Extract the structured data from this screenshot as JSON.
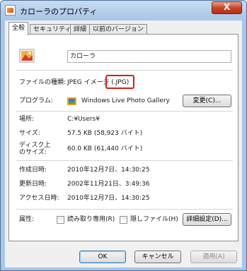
{
  "window": {
    "title": "カローラのプロパティ",
    "close_glyph": "X"
  },
  "tabs": [
    "全般",
    "セキュリティ",
    "詳細",
    "以前のバージョン"
  ],
  "file": {
    "name": "カローラ"
  },
  "rows": {
    "type": {
      "label": "ファイルの種類:",
      "value": "JPEG イメージ (.JPG)"
    },
    "program": {
      "label": "プログラム:",
      "value": "Windows Live Photo Gallery",
      "change_button": "変更(C)..."
    },
    "location": {
      "label": "場所:",
      "value": "C:¥Users¥"
    },
    "size": {
      "label": "サイズ:",
      "value": "57.5 KB (58,923 バイト)"
    },
    "size_on_disk": {
      "label_line1": "ディスク上",
      "label_line2": "のサイズ:",
      "value": "60.0 KB (61,440 バイト)"
    },
    "created": {
      "label": "作成日時:",
      "value": "2010年12月7日、14:30:25"
    },
    "modified": {
      "label": "更新日時:",
      "value": "2002年11月21日、3:49:36"
    },
    "accessed": {
      "label": "アクセス日時:",
      "value": "2010年12月7日、14:30:25"
    },
    "attributes": {
      "label": "属性:",
      "readonly": "読み取り専用(R)",
      "hidden": "隠しファイル(H)",
      "advanced_button": "詳細設定(D)..."
    }
  },
  "buttons": {
    "ok": "OK",
    "cancel": "キャンセル",
    "apply": "適用(A)"
  },
  "colors": {
    "highlight": "#d21e1e",
    "titlebar": "#a8c5e6"
  }
}
